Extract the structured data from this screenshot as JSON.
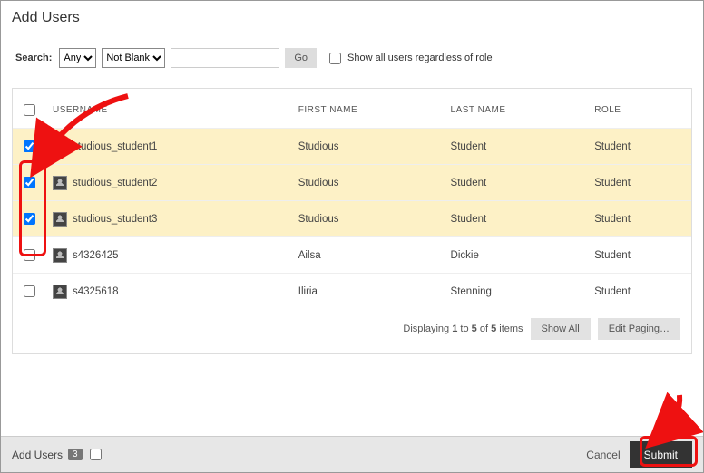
{
  "title": "Add Users",
  "search": {
    "label": "Search:",
    "field_options": [
      "Any"
    ],
    "field_value": "Any",
    "op_options": [
      "Not Blank"
    ],
    "op_value": "Not Blank",
    "text_value": "",
    "go_label": "Go",
    "show_all_label": "Show all users regardless of role",
    "show_all_checked": false
  },
  "table": {
    "headers": {
      "username": "USERNAME",
      "first_name": "FIRST NAME",
      "last_name": "LAST NAME",
      "role": "ROLE"
    },
    "rows": [
      {
        "checked": true,
        "username": "studious_student1",
        "first_name": "Studious",
        "last_name": "Student",
        "role": "Student"
      },
      {
        "checked": true,
        "username": "studious_student2",
        "first_name": "Studious",
        "last_name": "Student",
        "role": "Student"
      },
      {
        "checked": true,
        "username": "studious_student3",
        "first_name": "Studious",
        "last_name": "Student",
        "role": "Student"
      },
      {
        "checked": false,
        "username": "s4326425",
        "first_name": "Ailsa",
        "last_name": "Dickie",
        "role": "Student"
      },
      {
        "checked": false,
        "username": "s4325618",
        "first_name": "Iliria",
        "last_name": "Stenning",
        "role": "Student"
      }
    ]
  },
  "pager": {
    "text_prefix": "Displaying ",
    "from": "1",
    "mid": " to ",
    "to": "5",
    "of_word": " of ",
    "total": "5",
    "suffix": " items",
    "show_all": "Show All",
    "edit_paging": "Edit Paging…"
  },
  "footer": {
    "label": "Add Users",
    "count": "3",
    "cancel": "Cancel",
    "submit": "Submit"
  }
}
